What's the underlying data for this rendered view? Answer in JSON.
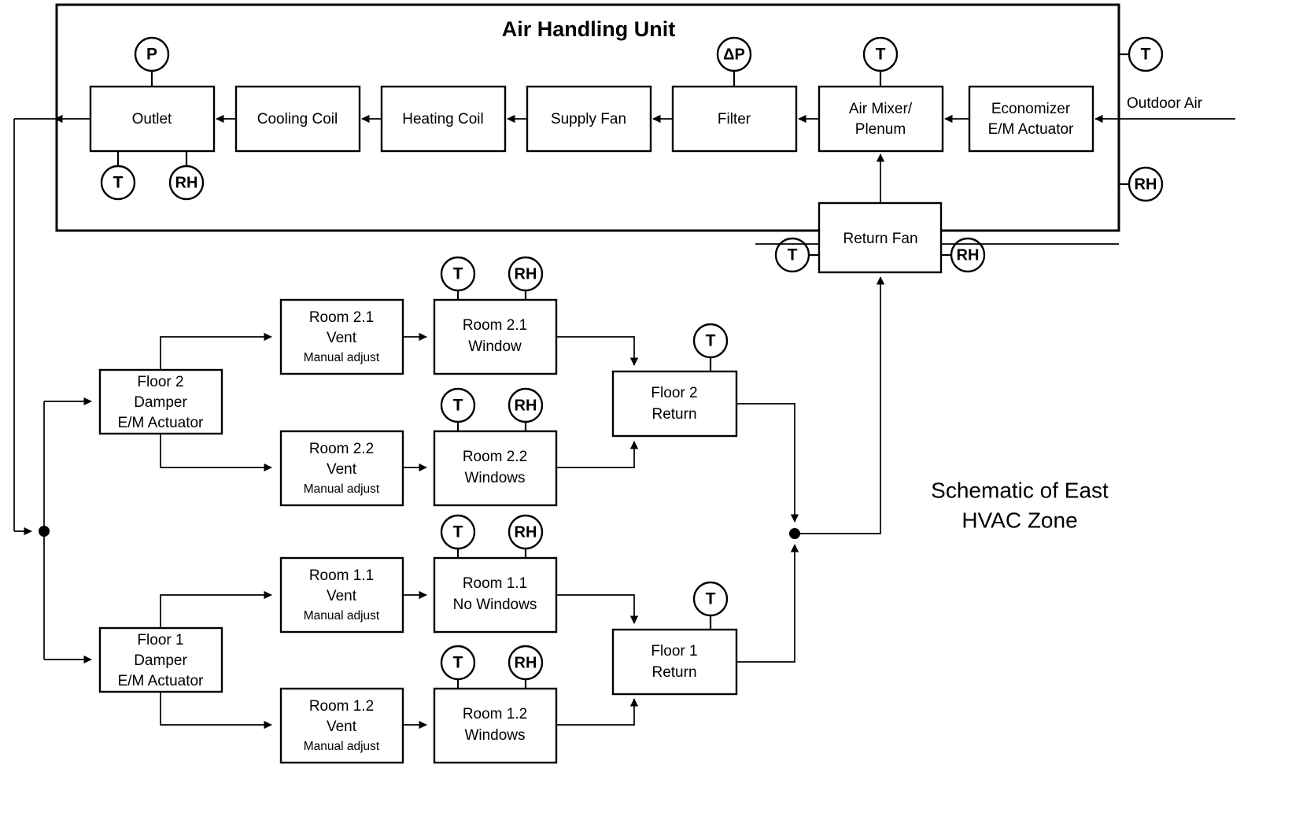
{
  "diagram": {
    "caption": {
      "line1": "Schematic of East",
      "line2": "HVAC Zone"
    },
    "ahu": {
      "title": "Air  Handling Unit",
      "outdoor_air_label": "Outdoor Air",
      "boxes": [
        {
          "id": "outlet",
          "label_lines": [
            "Outlet"
          ]
        },
        {
          "id": "cooling-coil",
          "label_lines": [
            "Cooling Coil"
          ]
        },
        {
          "id": "heating-coil",
          "label_lines": [
            "Heating Coil"
          ]
        },
        {
          "id": "supply-fan",
          "label_lines": [
            "Supply Fan"
          ]
        },
        {
          "id": "filter",
          "label_lines": [
            "Filter"
          ]
        },
        {
          "id": "air-mixer-plenum",
          "label_lines": [
            "Air Mixer/",
            "Plenum"
          ]
        },
        {
          "id": "economizer",
          "label_lines": [
            "Economizer",
            "E/M Actuator"
          ]
        }
      ],
      "sensors": [
        {
          "id": "outlet-pressure",
          "label": "P"
        },
        {
          "id": "outlet-temperature",
          "label": "T"
        },
        {
          "id": "outlet-humidity",
          "label": "RH"
        },
        {
          "id": "filter-delta-pressure",
          "label": "ΔP"
        },
        {
          "id": "mixer-temperature",
          "label": "T"
        },
        {
          "id": "outdoor-air-temperature",
          "label": "T"
        },
        {
          "id": "outdoor-air-humidity",
          "label": "RH"
        }
      ]
    },
    "return_fan": {
      "label": "Return Fan",
      "sensors": [
        {
          "id": "return-fan-temperature",
          "label": "T"
        },
        {
          "id": "return-fan-humidity",
          "label": "RH"
        }
      ]
    },
    "floors": [
      {
        "id": "floor-2",
        "damper": {
          "label_lines": [
            "Floor 2",
            "Damper",
            "E/M Actuator"
          ]
        },
        "return": {
          "label_lines": [
            "Floor 2",
            "Return"
          ],
          "sensor": {
            "id": "floor-2-return-temperature",
            "label": "T"
          }
        },
        "rooms": [
          {
            "id": "room-2-1",
            "vent": {
              "label_lines": [
                "Room 2.1",
                "Vent"
              ],
              "note": "Manual adjust"
            },
            "space": {
              "label_lines": [
                "Room 2.1",
                "Window"
              ]
            },
            "sensors": [
              {
                "id": "room-2-1-temperature",
                "label": "T"
              },
              {
                "id": "room-2-1-humidity",
                "label": "RH"
              }
            ]
          },
          {
            "id": "room-2-2",
            "vent": {
              "label_lines": [
                "Room 2.2",
                "Vent"
              ],
              "note": "Manual adjust"
            },
            "space": {
              "label_lines": [
                "Room 2.2",
                "Windows"
              ]
            },
            "sensors": [
              {
                "id": "room-2-2-temperature",
                "label": "T"
              },
              {
                "id": "room-2-2-humidity",
                "label": "RH"
              }
            ]
          }
        ]
      },
      {
        "id": "floor-1",
        "damper": {
          "label_lines": [
            "Floor 1",
            "Damper",
            "E/M Actuator"
          ]
        },
        "return": {
          "label_lines": [
            "Floor 1",
            "Return"
          ],
          "sensor": {
            "id": "floor-1-return-temperature",
            "label": "T"
          }
        },
        "rooms": [
          {
            "id": "room-1-1",
            "vent": {
              "label_lines": [
                "Room 1.1",
                "Vent"
              ],
              "note": "Manual adjust"
            },
            "space": {
              "label_lines": [
                "Room 1.1",
                "No Windows"
              ]
            },
            "sensors": [
              {
                "id": "room-1-1-temperature",
                "label": "T"
              },
              {
                "id": "room-1-1-humidity",
                "label": "RH"
              }
            ]
          },
          {
            "id": "room-1-2",
            "vent": {
              "label_lines": [
                "Room 1.2",
                "Vent"
              ],
              "note": "Manual adjust"
            },
            "space": {
              "label_lines": [
                "Room 1.2",
                "Windows"
              ]
            },
            "sensors": [
              {
                "id": "room-1-2-temperature",
                "label": "T"
              },
              {
                "id": "room-1-2-humidity",
                "label": "RH"
              }
            ]
          }
        ]
      }
    ],
    "colors": {
      "stroke": "#000000",
      "fill": "#ffffff"
    }
  }
}
